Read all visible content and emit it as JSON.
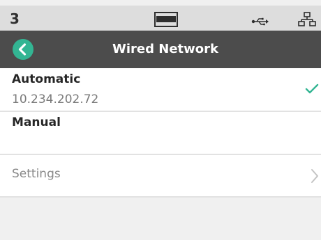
{
  "status_bar": {
    "number": "3",
    "icons": [
      "screen-icon",
      "usb-icon",
      "network-icon"
    ]
  },
  "header": {
    "title": "Wired Network",
    "back_icon": "back-arrow-icon",
    "accent_color": "#33b593",
    "background_color": "#4c4c4c"
  },
  "list": {
    "automatic": {
      "label": "Automatic",
      "value": "10.234.202.72",
      "selected": true,
      "indicator_icon": "checkmark-icon"
    },
    "manual": {
      "label": "Manual",
      "selected": false
    },
    "settings": {
      "label": "Settings",
      "indicator_icon": "chevron-right-icon"
    }
  }
}
